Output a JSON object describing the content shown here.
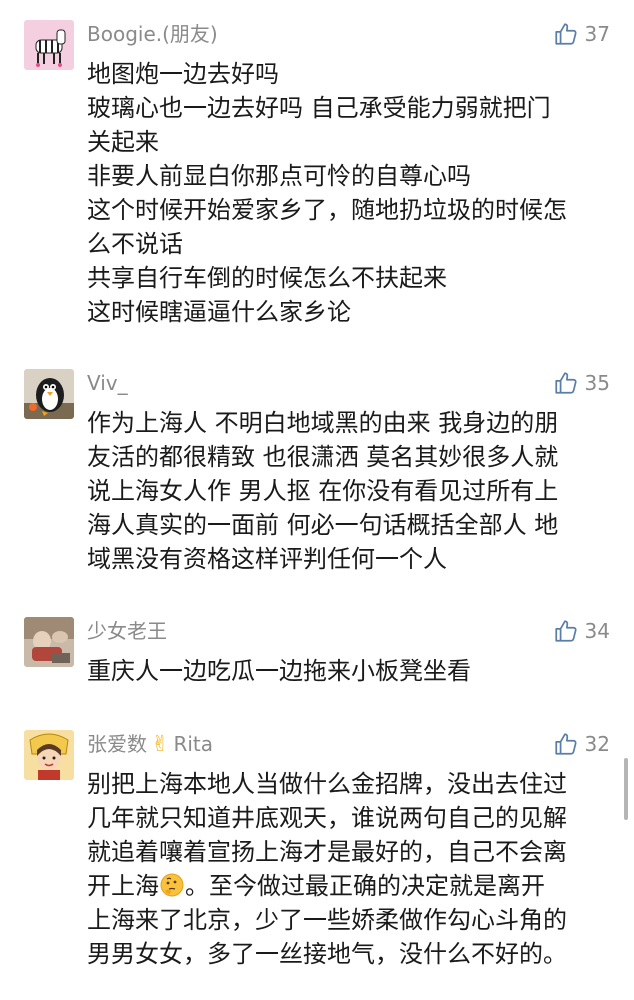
{
  "comments": [
    {
      "name": "Boogie.(朋友)",
      "avatar": "zebra-avatar-icon",
      "likes": "37",
      "lines": [
        "地图炮一边去好吗",
        "玻璃心也一边去好吗 自己承受能力弱就把门",
        "关起来",
        "非要人前显白你那点可怜的自尊心吗",
        "这个时候开始爱家乡了，随地扔垃圾的时候怎",
        "么不说话",
        "共享自行车倒的时候怎么不扶起来",
        "这时候瞎逼逼什么家乡论"
      ]
    },
    {
      "name": "Viv_",
      "avatar": "penguin-avatar-icon",
      "likes": "35",
      "lines": [
        "作为上海人 不明白地域黑的由来  我身边的朋",
        "友活的都很精致 也很潇洒  莫名其妙很多人就",
        "说上海女人作 男人抠 在你没有看见过所有上",
        "海人真实的一面前 何必一句话概括全部人 地",
        "域黑没有资格这样评判任何一个人"
      ]
    },
    {
      "name": "少女老王",
      "avatar": "photo-avatar-icon",
      "likes": "34",
      "lines": [
        "重庆人一边吃瓜一边拖来小板凳坐看"
      ]
    },
    {
      "name_prefix": "张爱数",
      "name_emoji": "✌",
      "name_suffix": "Rita",
      "avatar": "cartoon-girl-avatar-icon",
      "likes": "32",
      "lines": [
        "别把上海本地人当做什么金招牌，没出去住过",
        "几年就只知道井底观天，谁说两句自己的见解",
        "就追着嚷着宣扬上海才是最好的，自己不会离",
        "开上海",
        "。至今做过最正确的决定就是离开",
        "上海来了北京，少了一些娇柔做作勾心斗角的",
        "男男女女，多了一丝接地气，没什么不好的。"
      ],
      "inline_emoji": "thinking-face-emoji"
    }
  ],
  "colors": {
    "name": "#8a8a8a",
    "text": "#1a1a1a",
    "like_icon": "#5a7ea8"
  }
}
